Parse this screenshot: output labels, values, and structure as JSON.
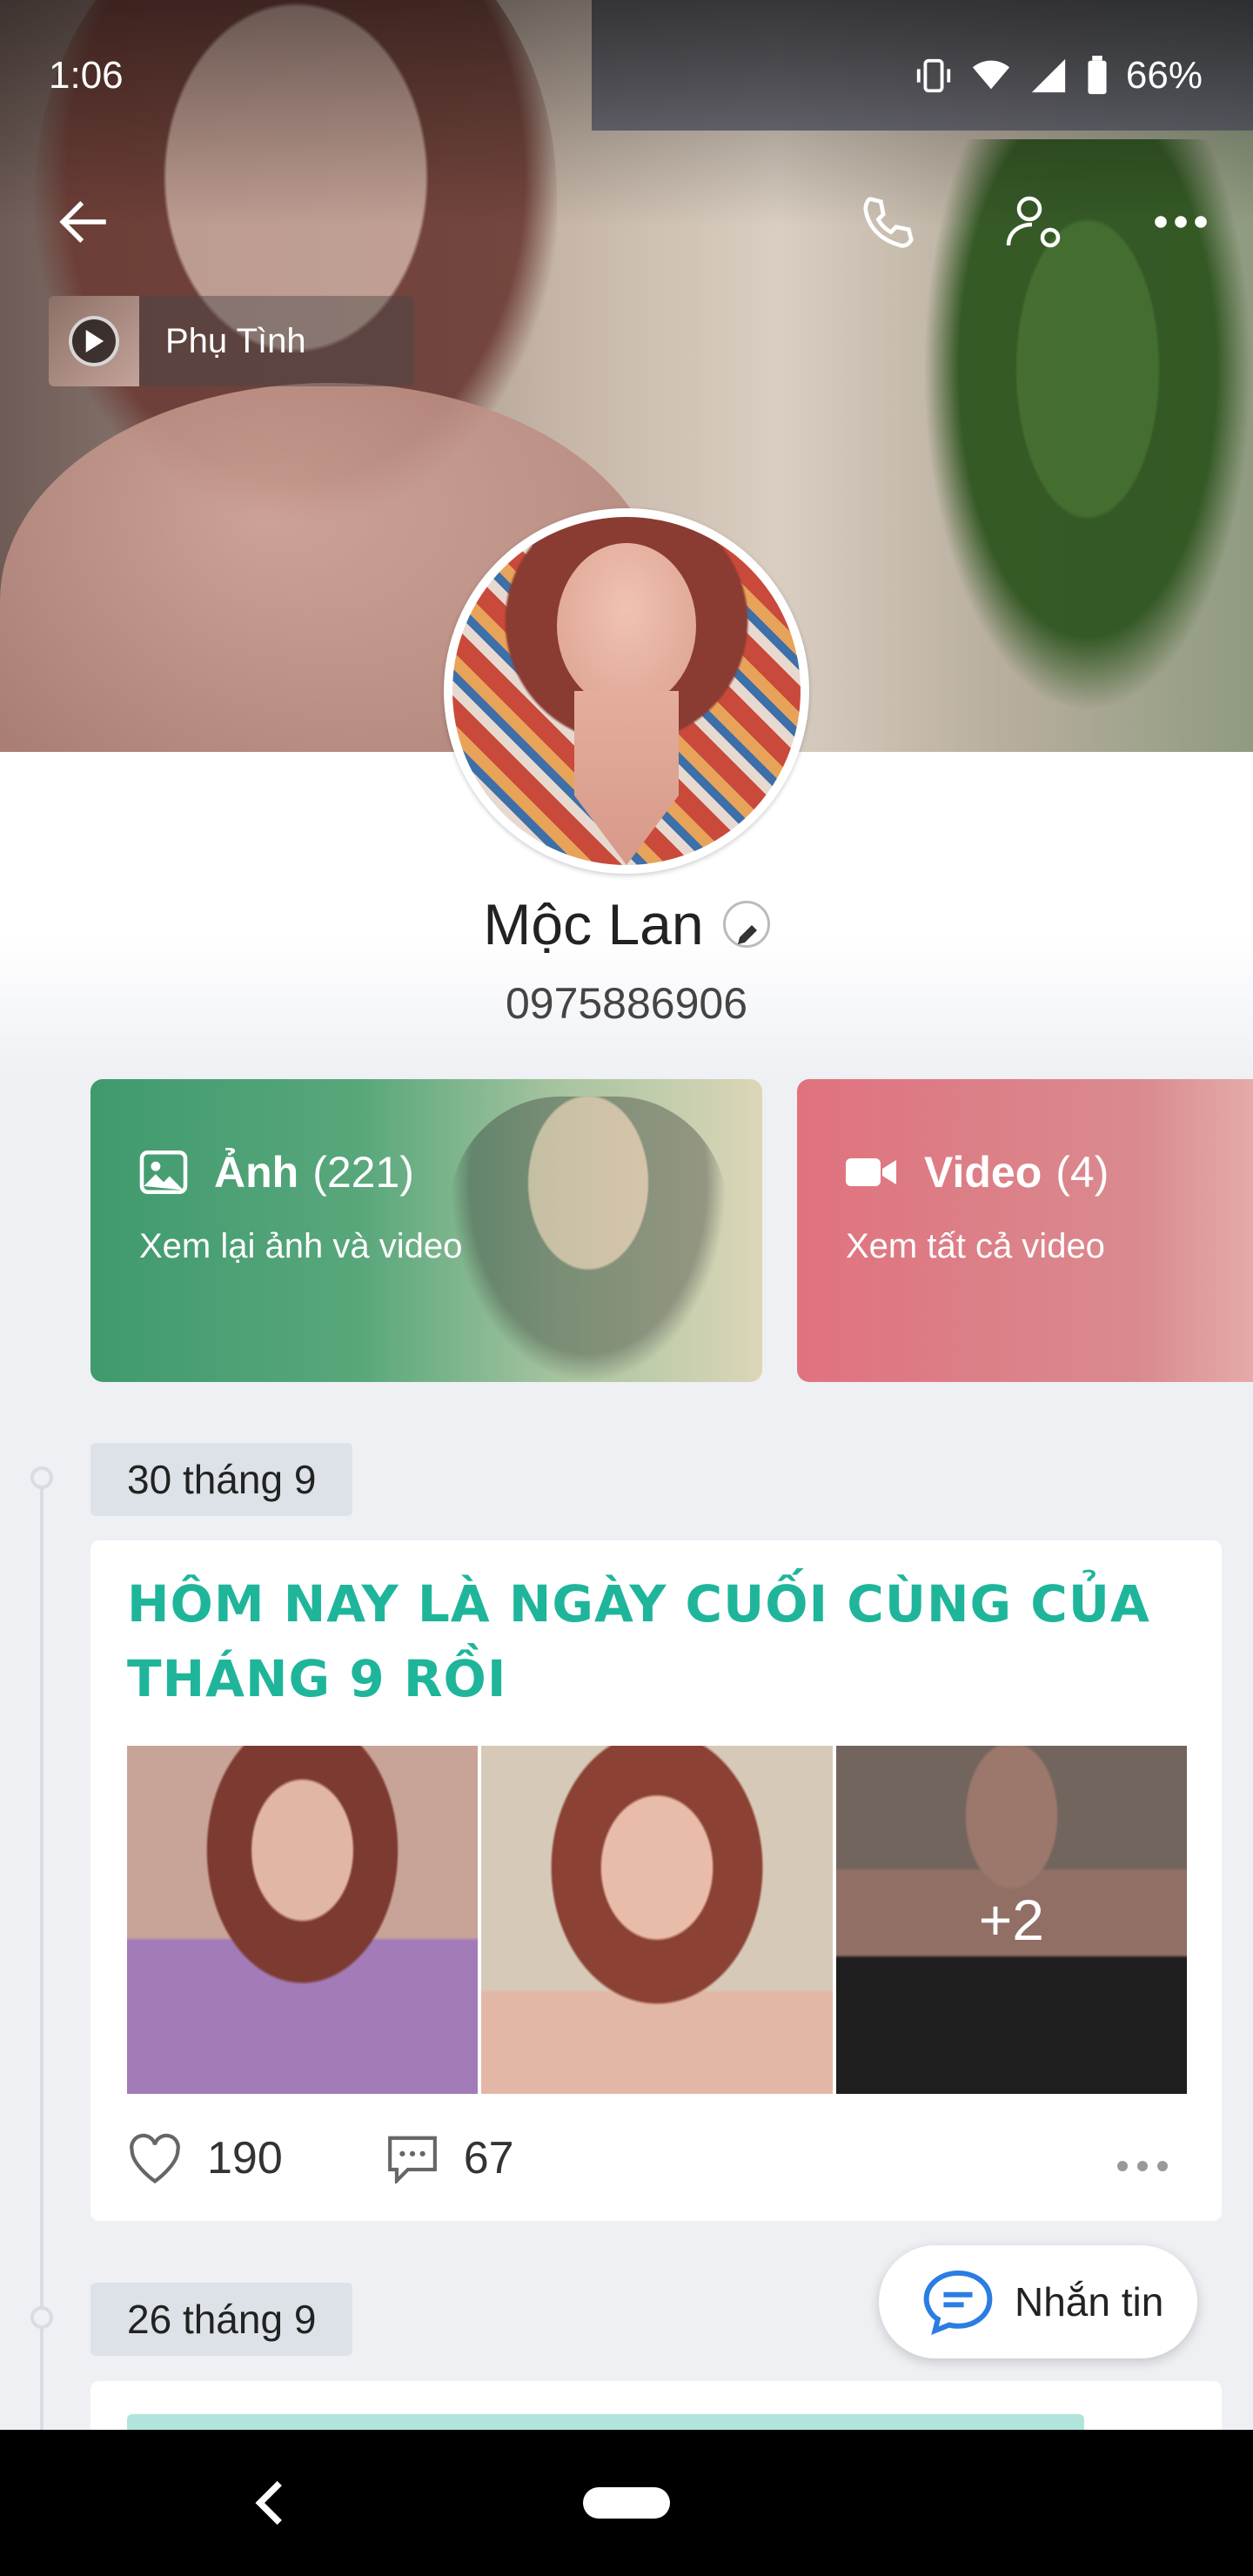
{
  "status_bar": {
    "time": "1:06",
    "battery": "66%"
  },
  "header": {
    "song_title": "Phụ Tình"
  },
  "profile": {
    "name": "Mộc Lan",
    "phone": "0975886906"
  },
  "media_cards": [
    {
      "title": "Ảnh",
      "count": "(221)",
      "subtitle": "Xem lại ảnh và video"
    },
    {
      "title": "Video",
      "count": "(4)",
      "subtitle": "Xem tất cả video"
    }
  ],
  "posts": [
    {
      "date": "30 tháng 9",
      "title": "HÔM NAY LÀ NGÀY CUỐI CÙNG CỦA THÁNG 9 RỒI",
      "more_photos": "+2",
      "likes": "190",
      "comments": "67"
    },
    {
      "date": "26 tháng 9"
    }
  ],
  "fab": {
    "label": "Nhắn tin"
  },
  "colors": {
    "accent": "#1fb59b",
    "photo_card": "#3f9a6e",
    "video_card": "#e0727e"
  },
  "icons": [
    "back-arrow-icon",
    "phone-icon",
    "user-settings-icon",
    "more-icon",
    "play-icon",
    "image-icon",
    "video-camera-icon",
    "heart-icon",
    "comment-icon",
    "chat-icon"
  ]
}
